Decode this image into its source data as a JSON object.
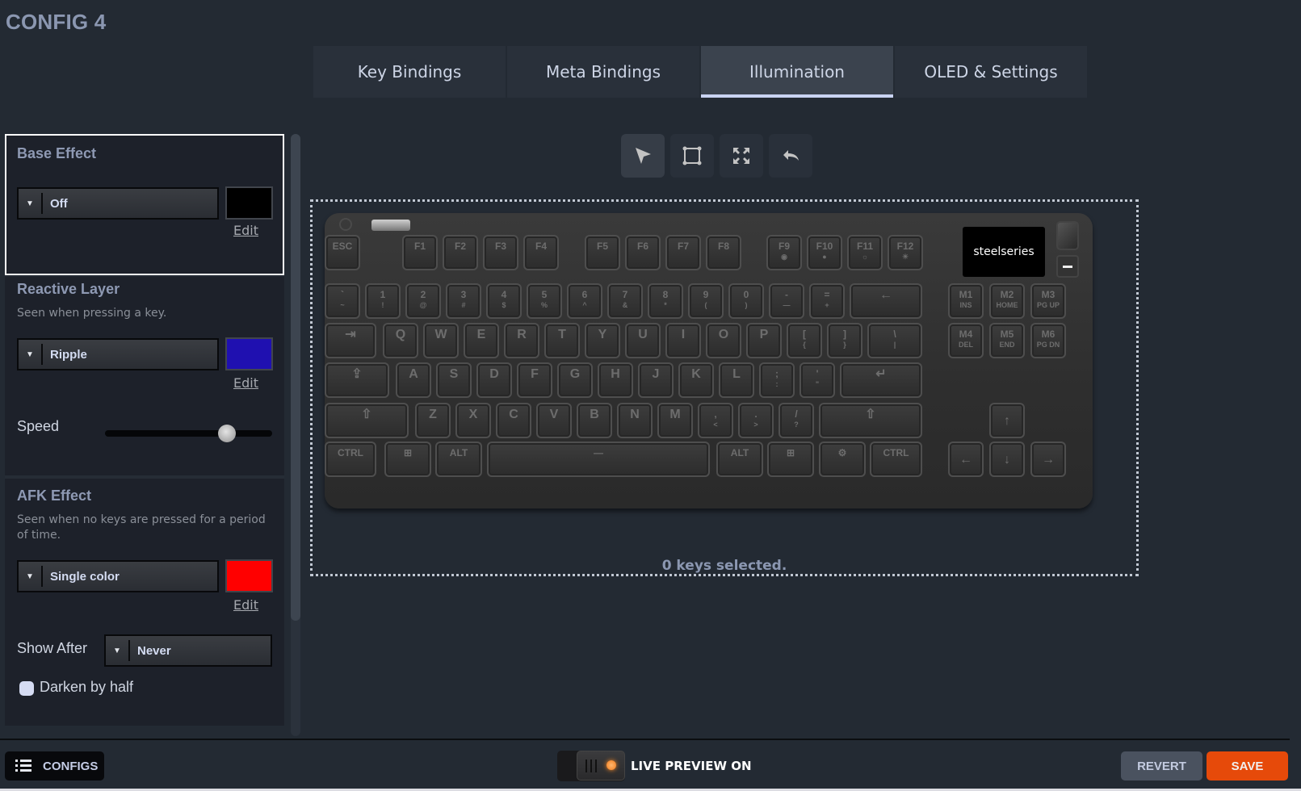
{
  "page_title": "CONFIG 4",
  "tabs": [
    {
      "label": "Key Bindings",
      "active": false
    },
    {
      "label": "Meta Bindings",
      "active": false
    },
    {
      "label": "Illumination",
      "active": true
    },
    {
      "label": "OLED & Settings",
      "active": false
    }
  ],
  "base_effect": {
    "title": "Base Effect",
    "effect": "Off",
    "color": "#000000",
    "edit_label": "Edit"
  },
  "reactive_layer": {
    "title": "Reactive Layer",
    "description": "Seen when pressing a key.",
    "effect": "Ripple",
    "color": "#1f10b0",
    "edit_label": "Edit",
    "speed_label": "Speed",
    "speed_fraction": 0.73
  },
  "afk_effect": {
    "title": "AFK Effect",
    "description": "Seen when no keys are pressed for a period of time.",
    "effect": "Single color",
    "color": "#ff0000",
    "edit_label": "Edit",
    "show_after_label": "Show After",
    "show_after_value": "Never",
    "darken_label": "Darken by half",
    "darken_checked": false
  },
  "tools": [
    {
      "name": "select-tool",
      "icon": "cursor-arrow-icon",
      "active": true
    },
    {
      "name": "rectangle-select-tool",
      "icon": "bounding-box-icon",
      "active": false
    },
    {
      "name": "select-all-tool",
      "icon": "expand-icon",
      "active": false
    },
    {
      "name": "undo-tool",
      "icon": "undo-icon",
      "active": false
    }
  ],
  "keyboard": {
    "oled_text": "steelseries",
    "rows": [
      [
        [
          "ESC",
          ""
        ],
        [
          "F1",
          ""
        ],
        [
          "F2",
          ""
        ],
        [
          "F3",
          ""
        ],
        [
          "F4",
          ""
        ],
        [
          "F5",
          ""
        ],
        [
          "F6",
          ""
        ],
        [
          "F7",
          ""
        ],
        [
          "F8",
          ""
        ],
        [
          "F9",
          "◉"
        ],
        [
          "F10",
          "●"
        ],
        [
          "F11",
          "☼"
        ],
        [
          "F12",
          "☀"
        ]
      ],
      [
        [
          "`",
          "~"
        ],
        [
          "1",
          "!"
        ],
        [
          "2",
          "@"
        ],
        [
          "3",
          "#"
        ],
        [
          "4",
          "$"
        ],
        [
          "5",
          "%"
        ],
        [
          "6",
          "^"
        ],
        [
          "7",
          "&"
        ],
        [
          "8",
          "*"
        ],
        [
          "9",
          "("
        ],
        [
          "0",
          ")"
        ],
        [
          "-",
          "—"
        ],
        [
          "=",
          "+"
        ],
        [
          "←",
          ""
        ]
      ],
      [
        [
          "⇥",
          ""
        ],
        [
          "Q",
          ""
        ],
        [
          "W",
          ""
        ],
        [
          "E",
          ""
        ],
        [
          "R",
          ""
        ],
        [
          "T",
          ""
        ],
        [
          "Y",
          ""
        ],
        [
          "U",
          ""
        ],
        [
          "I",
          ""
        ],
        [
          "O",
          ""
        ],
        [
          "P",
          ""
        ],
        [
          "[",
          "{"
        ],
        [
          "]",
          "}"
        ],
        [
          "\\",
          "|"
        ]
      ],
      [
        [
          "⇪",
          ""
        ],
        [
          "A",
          ""
        ],
        [
          "S",
          ""
        ],
        [
          "D",
          ""
        ],
        [
          "F",
          ""
        ],
        [
          "G",
          ""
        ],
        [
          "H",
          ""
        ],
        [
          "J",
          ""
        ],
        [
          "K",
          ""
        ],
        [
          "L",
          ""
        ],
        [
          ";",
          ":"
        ],
        [
          "'",
          "\""
        ],
        [
          "↵",
          ""
        ]
      ],
      [
        [
          "⇧",
          ""
        ],
        [
          "Z",
          ""
        ],
        [
          "X",
          ""
        ],
        [
          "C",
          ""
        ],
        [
          "V",
          ""
        ],
        [
          "B",
          ""
        ],
        [
          "N",
          ""
        ],
        [
          "M",
          ""
        ],
        [
          ",",
          "<"
        ],
        [
          ".",
          ">"
        ],
        [
          "/",
          "?"
        ],
        [
          "⇧",
          ""
        ]
      ],
      [
        [
          "CTRL",
          ""
        ],
        [
          "⊞",
          ""
        ],
        [
          "ALT",
          ""
        ],
        [
          "—",
          ""
        ],
        [
          "ALT",
          ""
        ],
        [
          "⊞",
          ""
        ],
        [
          "⚙",
          ""
        ],
        [
          "CTRL",
          ""
        ]
      ]
    ],
    "macro_keys": [
      [
        "M1",
        "INS"
      ],
      [
        "M2",
        "HOME"
      ],
      [
        "M3",
        "PG UP"
      ],
      [
        "M4",
        "DEL"
      ],
      [
        "M5",
        "END"
      ],
      [
        "M6",
        "PG DN"
      ]
    ],
    "arrow_keys": [
      "↑",
      "←",
      "↓",
      "→"
    ]
  },
  "selection_status": "0 keys selected.",
  "bottom_bar": {
    "configs_label": "CONFIGS",
    "live_preview_label": "LIVE PREVIEW ON",
    "live_preview_on": true,
    "revert_label": "REVERT",
    "save_label": "SAVE"
  }
}
